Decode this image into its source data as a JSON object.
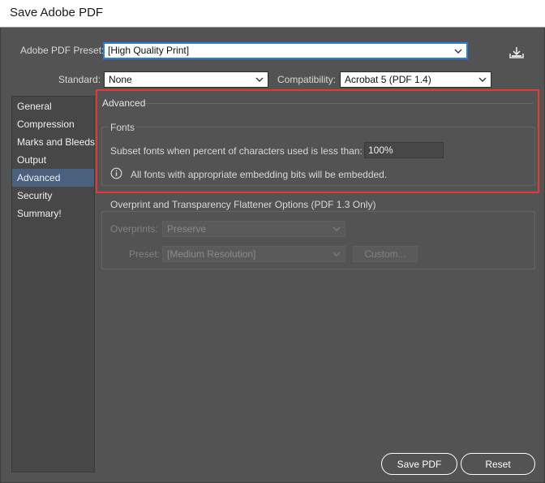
{
  "window": {
    "title": "Save Adobe PDF"
  },
  "preset": {
    "label": "Adobe PDF Preset:",
    "value": "[High Quality Print]",
    "download_icon": "download-icon"
  },
  "standard": {
    "label": "Standard:",
    "value": "None"
  },
  "compatibility": {
    "label": "Compatibility:",
    "value": "Acrobat 5 (PDF 1.4)"
  },
  "sidebar": {
    "items": [
      {
        "label": "General"
      },
      {
        "label": "Compression"
      },
      {
        "label": "Marks and Bleeds"
      },
      {
        "label": "Output"
      },
      {
        "label": "Advanced",
        "active": true
      },
      {
        "label": "Security"
      },
      {
        "label": "Summary!"
      }
    ]
  },
  "panel": {
    "title": "Advanced",
    "fonts": {
      "title": "Fonts",
      "subset_label": "Subset fonts when percent of characters used is less than:",
      "subset_value": "100%",
      "info_text": "All fonts with appropriate embedding bits will be embedded."
    },
    "overprint": {
      "title": "Overprint and Transparency Flattener Options (PDF 1.3 Only)",
      "overprints_label": "Overprints:",
      "overprints_value": "Preserve",
      "preset_label": "Preset:",
      "preset_value": "[Medium Resolution]",
      "custom_label": "Custom..."
    }
  },
  "buttons": {
    "save": "Save PDF",
    "reset": "Reset"
  },
  "colors": {
    "highlight": "#e53935",
    "active_item": "#4a607c",
    "focus_border": "#2b7be0",
    "background": "#535353"
  }
}
